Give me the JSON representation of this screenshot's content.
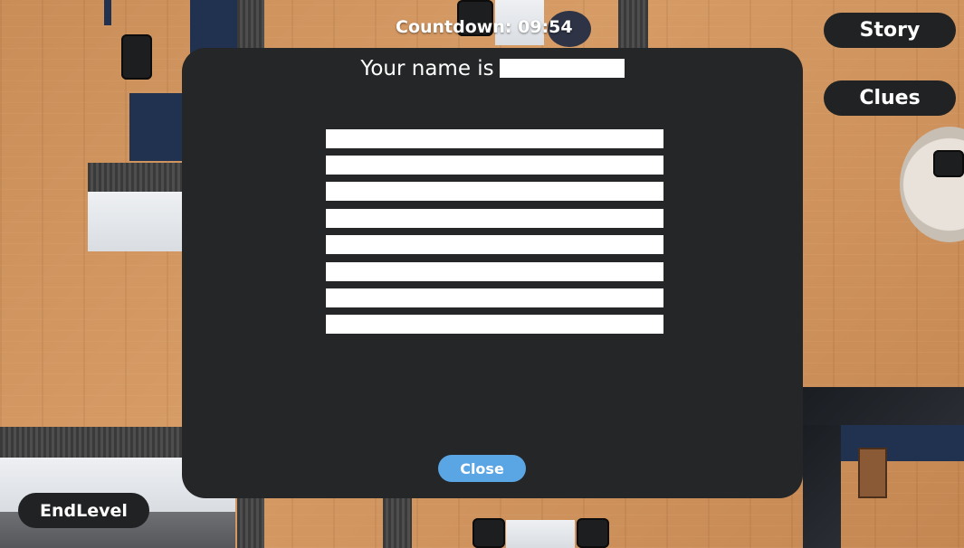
{
  "hud": {
    "countdown_label": "Countdown:",
    "countdown_value": "09:54",
    "story_label": "Story",
    "clues_label": "Clues",
    "endlevel_label": "EndLevel"
  },
  "modal": {
    "title_prefix": "Your name is",
    "close_label": "Close"
  },
  "colors": {
    "modal_bg": "#252627",
    "pill_bg": "#202223",
    "close_bg": "#5aa6e4",
    "floor": "#d09560"
  }
}
